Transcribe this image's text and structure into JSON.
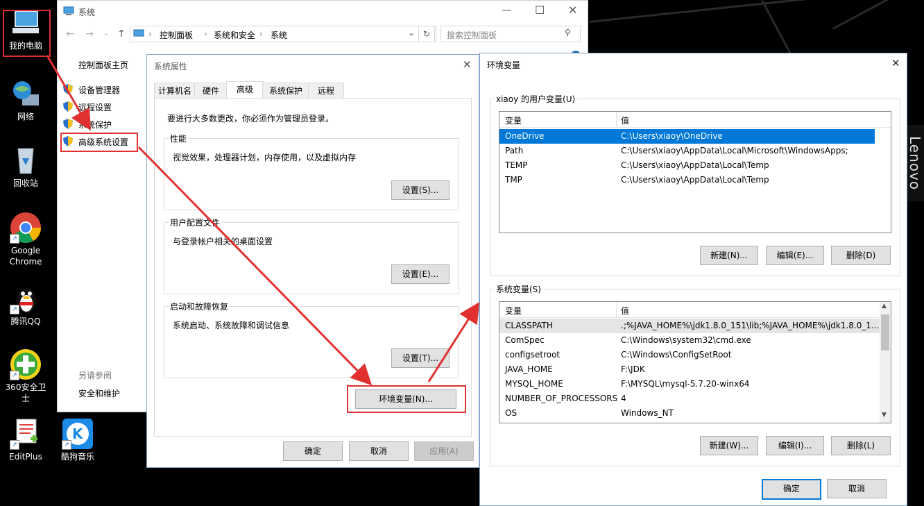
{
  "desktop": {
    "icons": [
      {
        "label": "我的电脑",
        "icon": "computer-icon"
      },
      {
        "label": "网络",
        "icon": "network-globe-icon"
      },
      {
        "label": "回收站",
        "icon": "recycle-bin-icon"
      },
      {
        "label": "Google Chrome",
        "icon": "chrome-icon"
      },
      {
        "label": "腾讯QQ",
        "icon": "qq-penguin-icon"
      },
      {
        "label": "360安全卫士",
        "icon": "360-guard-icon"
      },
      {
        "label": "EditPlus",
        "icon": "editplus-icon"
      },
      {
        "label": "酷狗音乐",
        "icon": "kugou-icon"
      }
    ],
    "brand": "Lenovo"
  },
  "system_window": {
    "title": "系统",
    "breadcrumb": [
      "控制面板",
      "系统和安全",
      "系统"
    ],
    "search_placeholder": "搜索控制面板",
    "sidebar": {
      "home": "控制面板主页",
      "links": [
        "设备管理器",
        "远程设置",
        "系统保护",
        "高级系统设置"
      ],
      "see_also_title": "另请参阅",
      "see_also_links": [
        "安全和维护"
      ]
    }
  },
  "props_dialog": {
    "title": "系统属性",
    "tabs": [
      "计算机名",
      "硬件",
      "高级",
      "系统保护",
      "远程"
    ],
    "active_tab": "高级",
    "admin_note": "要进行大多数更改，你必须作为管理员登录。",
    "performance": {
      "label": "性能",
      "desc": "视觉效果，处理器计划，内存使用，以及虚拟内存",
      "button": "设置(S)..."
    },
    "profile": {
      "label": "用户配置文件",
      "desc": "与登录帐户相关的桌面设置",
      "button": "设置(E)..."
    },
    "startup": {
      "label": "启动和故障恢复",
      "desc": "系统启动、系统故障和调试信息",
      "button": "设置(T)..."
    },
    "env_button": "环境变量(N)...",
    "ok": "确定",
    "cancel": "取消",
    "apply": "应用(A)"
  },
  "env_dialog": {
    "title": "环境变量",
    "user_group_label": "xiaoy 的用户变量(U)",
    "col_var": "变量",
    "col_val": "值",
    "user_vars": [
      {
        "name": "OneDrive",
        "value": "C:\\Users\\xiaoy\\OneDrive"
      },
      {
        "name": "Path",
        "value": "C:\\Users\\xiaoy\\AppData\\Local\\Microsoft\\WindowsApps;"
      },
      {
        "name": "TEMP",
        "value": "C:\\Users\\xiaoy\\AppData\\Local\\Temp"
      },
      {
        "name": "TMP",
        "value": "C:\\Users\\xiaoy\\AppData\\Local\\Temp"
      }
    ],
    "user_buttons": [
      "新建(N)...",
      "编辑(E)...",
      "删除(D)"
    ],
    "system_group_label": "系统变量(S)",
    "system_vars": [
      {
        "name": "CLASSPATH",
        "value": ".;%JAVA_HOME%\\jdk1.8.0_151\\lib;%JAVA_HOME%\\jdk1.8.0_1..."
      },
      {
        "name": "ComSpec",
        "value": "C:\\Windows\\system32\\cmd.exe"
      },
      {
        "name": "configsetroot",
        "value": "C:\\Windows\\ConfigSetRoot"
      },
      {
        "name": "JAVA_HOME",
        "value": "F:\\JDK"
      },
      {
        "name": "MYSQL_HOME",
        "value": "F:\\MYSQL\\mysql-5.7.20-winx64"
      },
      {
        "name": "NUMBER_OF_PROCESSORS",
        "value": "4"
      },
      {
        "name": "OS",
        "value": "Windows_NT"
      }
    ],
    "system_buttons": [
      "新建(W)...",
      "编辑(I)...",
      "删除(L)"
    ],
    "ok": "确定",
    "cancel": "取消"
  },
  "colors": {
    "highlight_red": "#e03030",
    "selection_blue": "#0078d7"
  }
}
